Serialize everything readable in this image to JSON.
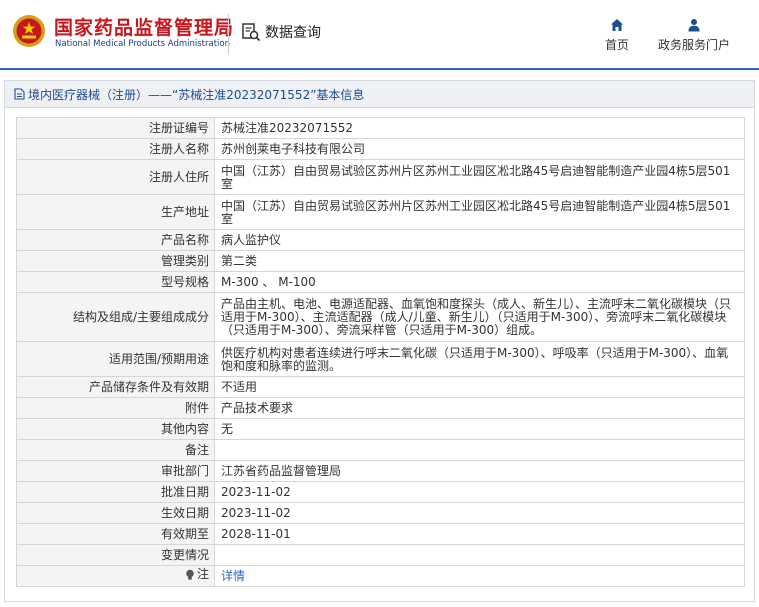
{
  "header": {
    "brand_cn": "国家药品监督管理局",
    "brand_en": "National Medical Products Administration",
    "data_query_label": "数据查询",
    "nav": [
      {
        "label": "首页",
        "icon": "home-icon"
      },
      {
        "label": "政务服务门户",
        "icon": "user-icon"
      }
    ],
    "accent_color": "#2b68b5",
    "brand_color": "#c8161d"
  },
  "panel": {
    "title": "境内医疗器械（注册）——“苏械注准20232071552”基本信息",
    "icon": "document-icon"
  },
  "rows": [
    {
      "label": "注册证编号",
      "value": "苏械注准20232071552"
    },
    {
      "label": "注册人名称",
      "value": "苏州创莱电子科技有限公司"
    },
    {
      "label": "注册人住所",
      "value": "中国（江苏）自由贸易试验区苏州片区苏州工业园区凇北路45号启迪智能制造产业园4栋5层501室"
    },
    {
      "label": "生产地址",
      "value": "中国（江苏）自由贸易试验区苏州片区苏州工业园区凇北路45号启迪智能制造产业园4栋5层501室"
    },
    {
      "label": "产品名称",
      "value": "病人监护仪"
    },
    {
      "label": "管理类别",
      "value": "第二类"
    },
    {
      "label": "型号规格",
      "value": "M-300 、 M-100"
    },
    {
      "label": "结构及组成/主要组成成分",
      "value": "产品由主机、电池、电源适配器、血氧饱和度探头（成人、新生儿）、主流呼末二氧化碳模块（只适用于M-300）、主流适配器（成人/儿童、新生儿）（只适用于M-300）、旁流呼末二氧化碳模块（只适用于M-300）、旁流采样管（只适用于M-300）组成。"
    },
    {
      "label": "适用范围/预期用途",
      "value": "供医疗机构对患者连续进行呼末二氧化碳（只适用于M-300）、呼吸率（只适用于M-300）、血氧饱和度和脉率的监测。"
    },
    {
      "label": "产品储存条件及有效期",
      "value": "不适用"
    },
    {
      "label": "附件",
      "value": "产品技术要求"
    },
    {
      "label": "其他内容",
      "value": "无"
    },
    {
      "label": "备注",
      "value": ""
    },
    {
      "label": "审批部门",
      "value": "江苏省药品监督管理局"
    },
    {
      "label": "批准日期",
      "value": "2023-11-02"
    },
    {
      "label": "生效日期",
      "value": "2023-11-02"
    },
    {
      "label": "有效期至",
      "value": "2028-11-01"
    },
    {
      "label": "变更情况",
      "value": ""
    },
    {
      "label": "注",
      "value": "详情",
      "icon": "lightbulb-icon"
    }
  ]
}
